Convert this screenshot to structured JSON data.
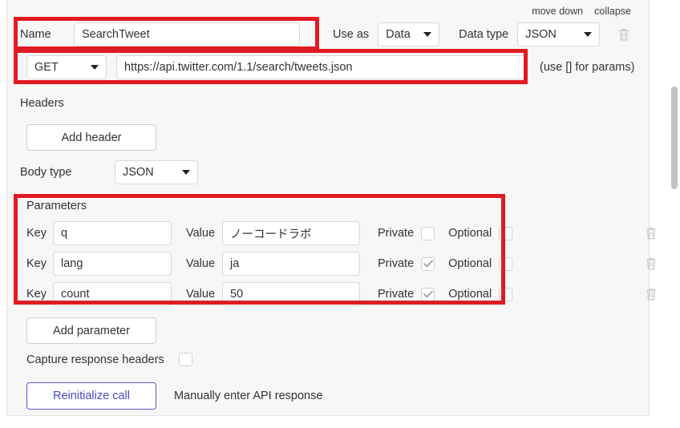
{
  "header": {
    "move_down": "move down",
    "collapse": "collapse"
  },
  "name_row": {
    "label": "Name",
    "value": "SearchTweet",
    "placeholder": "",
    "use_as_label": "Use as",
    "use_as_value": "Data",
    "data_type_label": "Data type",
    "data_type_value": "JSON",
    "delete_icon": "trash-icon"
  },
  "url_row": {
    "method": "GET",
    "url": "https://api.twitter.com/1.1/search/tweets.json",
    "hint": "(use [] for params)"
  },
  "headers": {
    "label": "Headers",
    "add_button": "Add header"
  },
  "body": {
    "label": "Body type",
    "value": "JSON"
  },
  "parameters": {
    "label": "Parameters",
    "key_label": "Key",
    "value_label": "Value",
    "private_label": "Private",
    "optional_label": "Optional",
    "add_button": "Add parameter",
    "rows": [
      {
        "key": "q",
        "value": "ノーコードラボ",
        "private": false,
        "optional": false
      },
      {
        "key": "lang",
        "value": "ja",
        "private": true,
        "optional": false
      },
      {
        "key": "count",
        "value": "50",
        "private": true,
        "optional": false
      }
    ]
  },
  "capture": {
    "label": "Capture response headers",
    "checked": false
  },
  "footer": {
    "reinitialize": "Reinitialize call",
    "manual": "Manually enter API response"
  },
  "colors": {
    "annotation_red": "#e01b22",
    "primary_purple": "#5b5bd6",
    "panel_bg": "#f7f7f7",
    "field_border": "#d8d8d8"
  }
}
